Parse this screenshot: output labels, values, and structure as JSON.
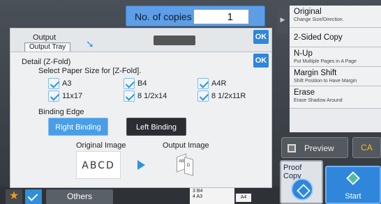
{
  "copies": {
    "label": "No. of copies",
    "value": "1"
  },
  "right_menu": [
    {
      "title": "Original",
      "subtitle": "Change Size/Direction."
    },
    {
      "title": "2-Sided Copy",
      "subtitle": ""
    },
    {
      "title": "N-Up",
      "subtitle": "Put Multiple Pages in A Page"
    },
    {
      "title": "Margin Shift",
      "subtitle": "Shift Position to Have Margin"
    },
    {
      "title": "Erase",
      "subtitle": "Erase Shadow Around"
    }
  ],
  "preview": {
    "label": "Preview",
    "ca_label": "CA"
  },
  "proof_copy": {
    "label": "Proof Copy"
  },
  "start": {
    "label": "Start"
  },
  "bottom": {
    "others_label": "Others",
    "tray_rows": [
      "3  B4",
      "4  A3"
    ],
    "tray_size": "A4"
  },
  "back_dialog": {
    "output_label": "Output",
    "tray_label": "Output Tray",
    "ok_label": "OK"
  },
  "dialog": {
    "title": "Detail (Z-Fold)",
    "subtitle": "Select Paper Size for [Z-Fold].",
    "ok_label": "OK",
    "paper_sizes": [
      "A3",
      "B4",
      "A4R",
      "11x17",
      "8 1/2x14",
      "8 1/2x11R"
    ],
    "binding_edge_label": "Binding Edge",
    "right_binding": "Right Binding",
    "left_binding": "Left Binding",
    "original_image_label": "Original Image",
    "output_image_label": "Output Image",
    "original_image_text": "ABCD",
    "output_image_text": [
      "AB",
      "D"
    ]
  }
}
